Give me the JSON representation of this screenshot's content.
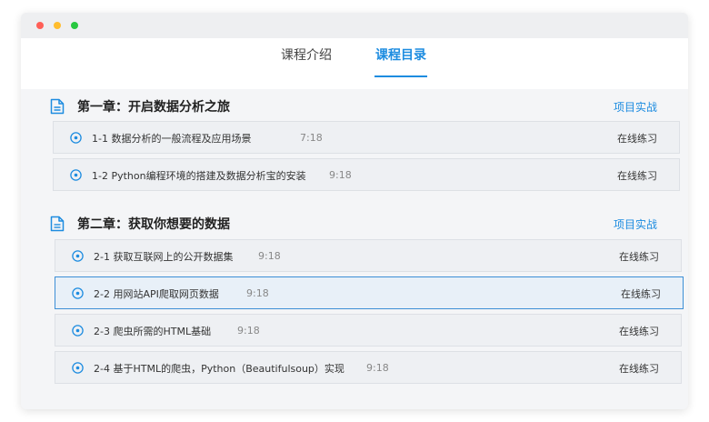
{
  "tabs": [
    {
      "label": "课程介绍",
      "active": false
    },
    {
      "label": "课程目录",
      "active": true
    }
  ],
  "accent_color": "#1d8ce0",
  "chapters": [
    {
      "title": "第一章：开启数据分析之旅",
      "project_label": "项目实战",
      "lessons": [
        {
          "title": "1-1 数据分析的一般流程及应用场景",
          "duration": "7:18",
          "practice": "在线练习"
        },
        {
          "title": "1-2 Python编程环境的搭建及数据分析宝的安装",
          "duration": "9:18",
          "practice": "在线练习"
        }
      ]
    },
    {
      "title": "第二章：获取你想要的数据",
      "project_label": "项目实战",
      "lessons": [
        {
          "title": "2-1 获取互联网上的公开数据集",
          "duration": "9:18",
          "practice": "在线练习"
        },
        {
          "title": "2-2 用网站API爬取网页数据",
          "duration": "9:18",
          "practice": "在线练习",
          "selected": true
        },
        {
          "title": "2-3 爬虫所需的HTML基础",
          "duration": "9:18",
          "practice": "在线练习"
        },
        {
          "title": "2-4 基于HTML的爬虫，Python（Beautifulsoup）实现",
          "duration": "9:18",
          "practice": "在线练习"
        }
      ]
    }
  ]
}
